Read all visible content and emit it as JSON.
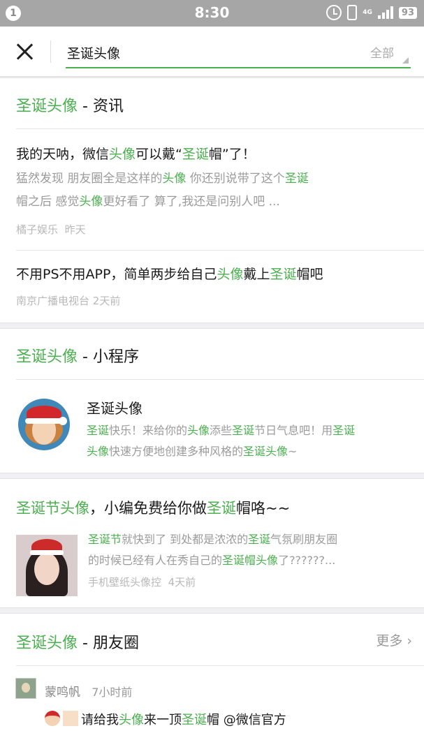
{
  "status_bar": {
    "notification_count": "1",
    "time": "8:30",
    "network": "4G",
    "battery": "93"
  },
  "search": {
    "query": "圣诞头像",
    "filter": "全部"
  },
  "news": {
    "title_hl": "圣诞头像",
    "title_rest": " - 资讯",
    "items": [
      {
        "title": [
          "我的天呐，微信",
          "头像",
          "可以戴“",
          "圣诞",
          "帽”了！"
        ],
        "desc_line1": [
          "猛然发现 朋友圈全是这样的",
          "头像",
          " 你还别说带了这个",
          "圣诞"
        ],
        "desc_line2": [
          "帽之后 感觉",
          "头像",
          "更好看了 算了,我还是问别人吧 ..."
        ],
        "source": "橘子娱乐",
        "time": "昨天"
      },
      {
        "title": [
          "不用PS不用APP，简单两步给自己",
          "头像",
          "戴上",
          "圣诞",
          "帽吧"
        ],
        "source": "南京广播电视台",
        "time": "2天前"
      }
    ]
  },
  "mini_program": {
    "title_hl": "圣诞头像",
    "title_rest": " - 小程序",
    "name": "圣诞头像",
    "desc_line1": [
      "圣诞",
      "快乐！来给你的",
      "头像",
      "添些",
      "圣诞",
      "节日气息吧！用",
      "圣诞"
    ],
    "desc_line2": [
      "头像",
      "快速方便地创建多种风格的",
      "圣诞头像",
      "~"
    ]
  },
  "article": {
    "title": [
      "圣诞节头像",
      "，小编免费给你做",
      "圣诞",
      "帽咯~~"
    ],
    "desc_line1": [
      "圣诞节",
      "就快到了 到处都是浓浓的",
      "圣诞",
      "气氛刷朋友圈"
    ],
    "desc_line2": [
      "的时候已经有人在秀自己的",
      "圣诞",
      "帽",
      "头像",
      "了??????..."
    ],
    "source": "手机壁纸头像控",
    "time": "4天前"
  },
  "moments": {
    "title_hl": "圣诞头像",
    "title_rest": " - 朋友圈",
    "more": "更多",
    "post": {
      "user": "蒙鸣帆",
      "time": "7小时前",
      "text": [
        "请给我",
        "头像",
        "来一顶",
        "圣诞",
        "帽 @微信官方"
      ]
    }
  },
  "colors": {
    "accent": "#4caf50",
    "status_bar": "#a6a6a6",
    "secondary_text": "#9b9b9b"
  }
}
